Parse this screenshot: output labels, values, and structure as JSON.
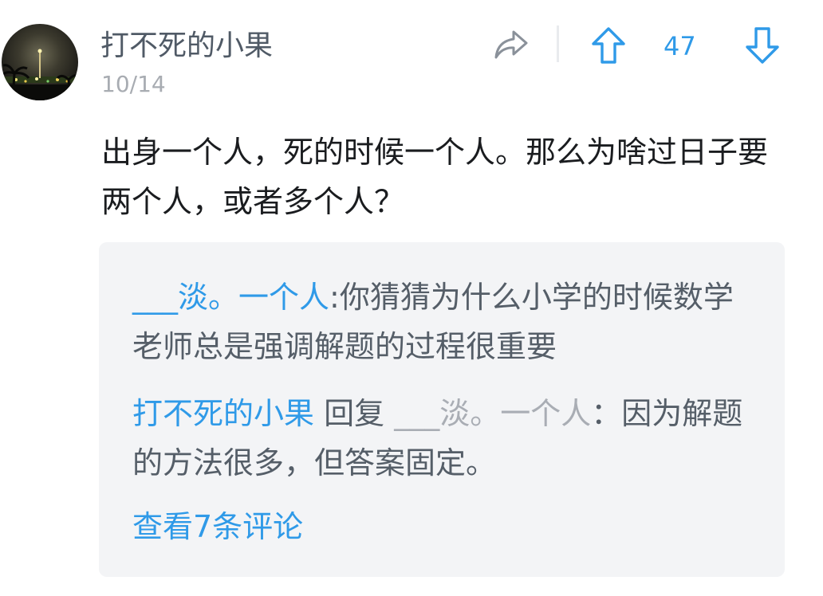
{
  "post": {
    "author": "打不死的小果",
    "date": "10/14",
    "vote_count": "47",
    "content": "出身一个人，死的时候一个人。那么为啥过日子要两个人，或者多个人？"
  },
  "replies": [
    {
      "author": "___淡。一个人",
      "separator": ":",
      "text": "你猜猜为什么小学的时候数学老师总是强调解题的过程很重要"
    },
    {
      "author": "打不死的小果",
      "reply_word": "回复",
      "reply_to": "___淡。一个人",
      "separator": "：",
      "text": "因为解题的方法很多，但答案固定。"
    }
  ],
  "view_more": "查看7条评论",
  "icons": {
    "share": "share-icon",
    "upvote": "arrow-up-icon",
    "downvote": "arrow-down-icon"
  },
  "colors": {
    "accent": "#2f9ae8",
    "username": "#505a66",
    "date": "#a8acb2",
    "reply_box": "#f3f4f6"
  }
}
